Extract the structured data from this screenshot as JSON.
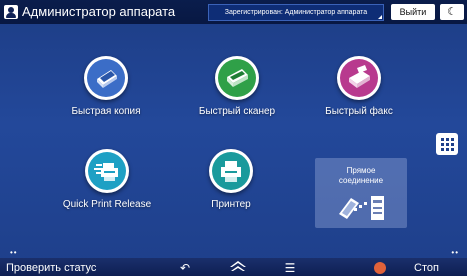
{
  "header": {
    "admin_label": "Администратор аппарата",
    "login_status": "Зарегистрирован: Администратор аппарата",
    "logout_label": "Выйти",
    "sleep_icon": "moon-icon"
  },
  "apps": [
    {
      "label": "Быстрая копия",
      "icon": "copy-icon",
      "color": "#3b6dc7"
    },
    {
      "label": "Быстрый сканер",
      "icon": "scanner-icon",
      "color": "#2fa048"
    },
    {
      "label": "Быстрый факс",
      "icon": "fax-icon",
      "color": "#b83a8e"
    },
    {
      "label": "Quick Print Release",
      "icon": "quick-print-release-icon",
      "color": "#1ea0c4"
    },
    {
      "label": "Принтер",
      "icon": "printer-icon",
      "color": "#1a9a9c"
    }
  ],
  "direct_connect": {
    "label_line1": "Прямое",
    "label_line2": "соединение",
    "icon": "phone-to-printer-icon"
  },
  "apps_list_icon": "grid-icon",
  "bottom": {
    "check_status": "Проверить статус",
    "back_icon": "back-arrow-icon",
    "home_icon": "home-icon",
    "menu_icon": "menu-icon",
    "stop_label": "Стоп",
    "stop_color": "#e0623a"
  },
  "page_indicator": "••"
}
